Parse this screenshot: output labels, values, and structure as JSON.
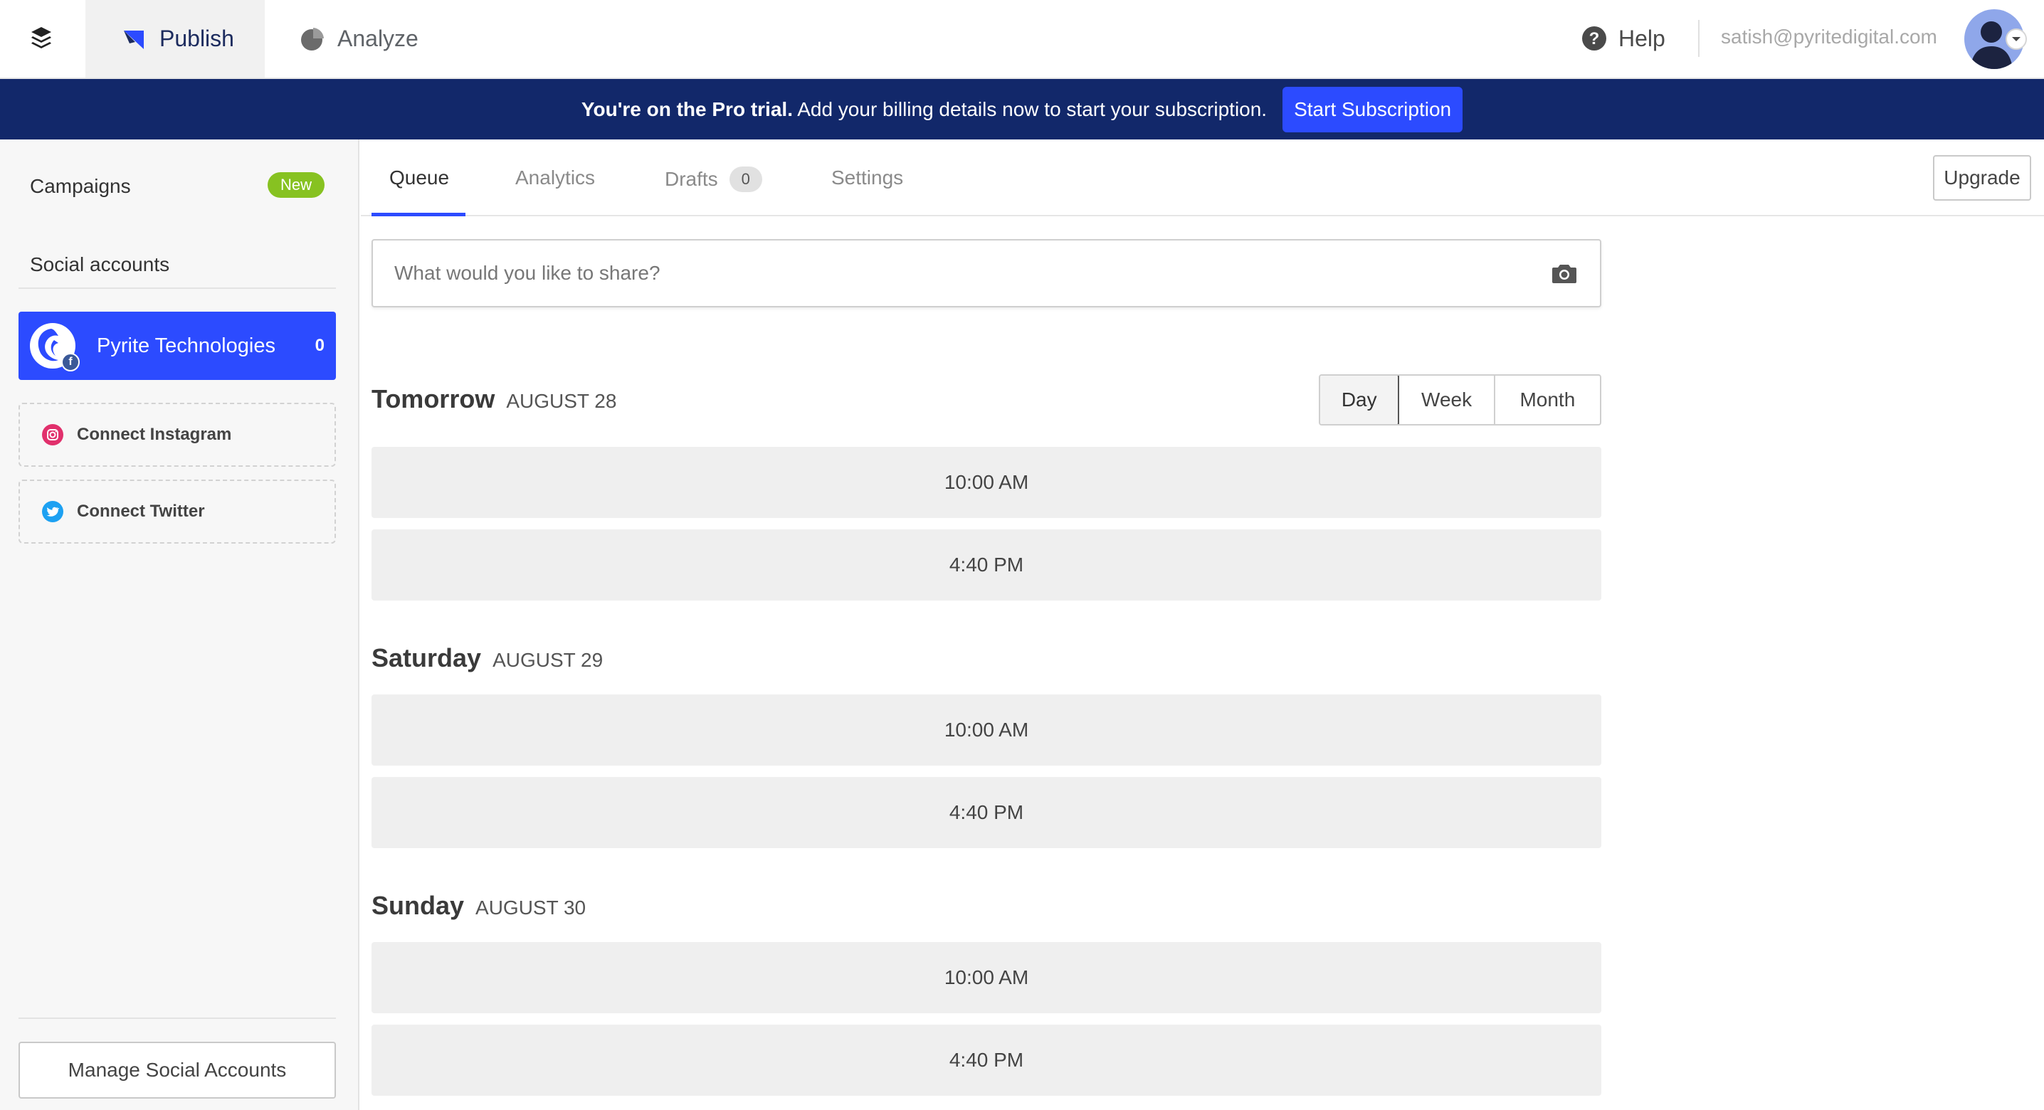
{
  "topnav": {
    "publish_label": "Publish",
    "analyze_label": "Analyze",
    "help_label": "Help",
    "user_email": "satish@pyritedigital.com"
  },
  "banner": {
    "bold_text": "You're on the Pro trial.",
    "text": " Add your billing details now to start your subscription.",
    "button_label": "Start Subscription"
  },
  "sidebar": {
    "campaigns_label": "Campaigns",
    "campaigns_badge": "New",
    "social_title": "Social accounts",
    "account": {
      "name": "Pyrite Technologies",
      "count": "0"
    },
    "connect_instagram": "Connect Instagram",
    "connect_twitter": "Connect Twitter",
    "manage_label": "Manage Social Accounts"
  },
  "tabs": {
    "queue": "Queue",
    "analytics": "Analytics",
    "drafts": "Drafts",
    "drafts_count": "0",
    "settings": "Settings",
    "upgrade": "Upgrade"
  },
  "composer": {
    "placeholder": "What would you like to share?"
  },
  "view_toggle": {
    "day": "Day",
    "week": "Week",
    "month": "Month",
    "selected": "Day"
  },
  "schedule": [
    {
      "day": "Tomorrow",
      "date": "AUGUST 28",
      "slots": [
        "10:00 AM",
        "4:40 PM"
      ]
    },
    {
      "day": "Saturday",
      "date": "AUGUST 29",
      "slots": [
        "10:00 AM",
        "4:40 PM"
      ]
    },
    {
      "day": "Sunday",
      "date": "AUGUST 30",
      "slots": [
        "10:00 AM",
        "4:40 PM"
      ]
    }
  ],
  "colors": {
    "banner_bg": "#12286a",
    "accent_blue": "#2c4bff",
    "new_badge": "#87c221",
    "instagram": "#e1306c",
    "twitter": "#1da1f2",
    "facebook": "#3b5998"
  },
  "icons": {
    "logo": "layers-icon",
    "publish": "publish-arrow-icon",
    "analyze": "pie-chart-icon",
    "help": "question-circle-icon",
    "camera": "camera-icon",
    "instagram": "instagram-icon",
    "twitter": "twitter-icon"
  }
}
